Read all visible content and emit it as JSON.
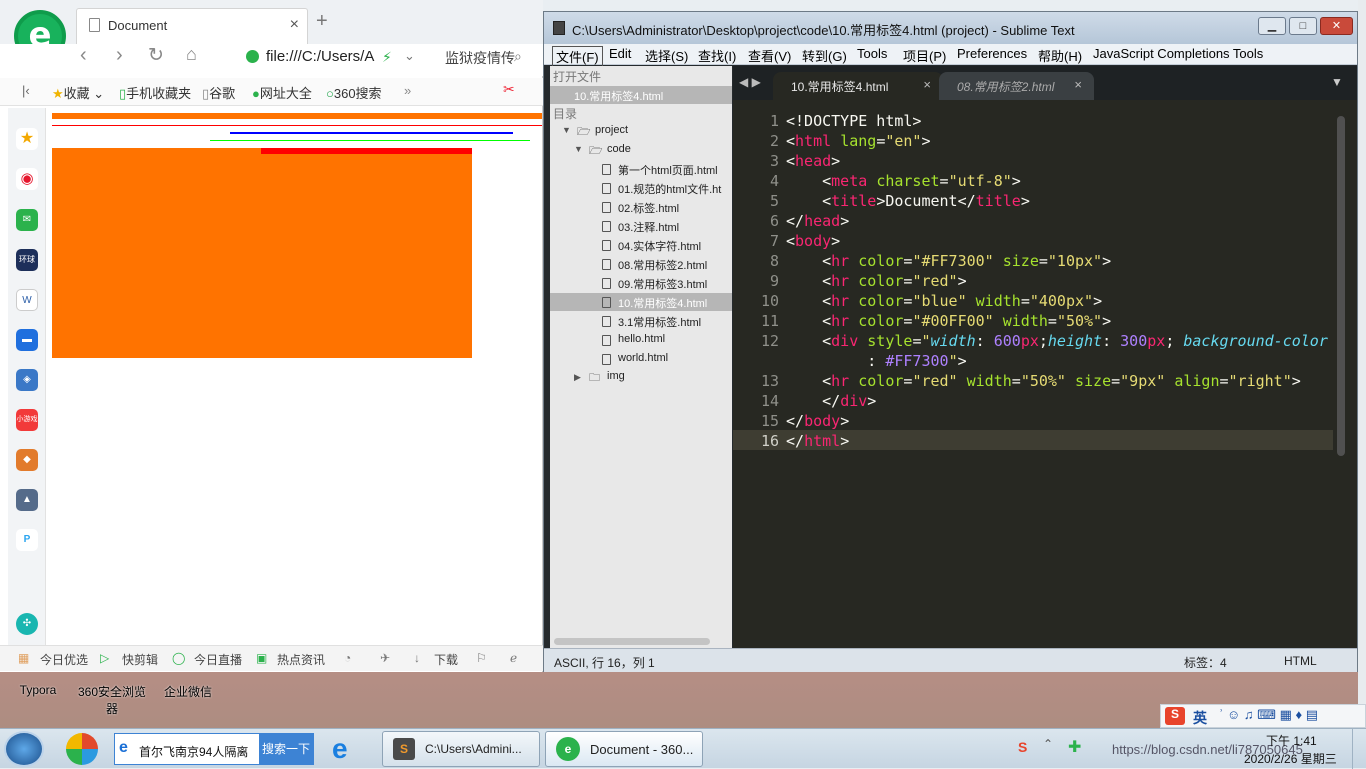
{
  "browser": {
    "tab_title": "Document",
    "url": "file:///C:/Users/A",
    "hot_search": "监狱疫情传",
    "bookmarks": [
      "收藏",
      "手机收藏夹",
      "谷歌",
      "网址大全",
      "360搜索"
    ],
    "page": {
      "hr_colors": [
        "#FF7300",
        "red",
        "blue",
        "#00FF00"
      ],
      "div_color": "#FF7300",
      "inner_hr_color": "red"
    },
    "status_items": [
      "今日优选",
      "快剪辑",
      "今日直播",
      "热点资讯",
      "下载"
    ]
  },
  "sublime": {
    "title": "C:\\Users\\Administrator\\Desktop\\project\\code\\10.常用标签4.html (project) - Sublime Text",
    "menu": [
      "文件(F)",
      "Edit",
      "选择(S)",
      "查找(I)",
      "查看(V)",
      "转到(G)",
      "Tools",
      "项目(P)",
      "Preferences",
      "帮助(H)",
      "JavaScript Completions Tools"
    ],
    "sidebar": {
      "open_files_header": "打开文件",
      "open_file": "10.常用标签4.html",
      "folders_header": "目录",
      "project": "project",
      "code": "code",
      "files": [
        "第一个html页面.html",
        "01.规范的html文件.ht",
        "02.标签.html",
        "03.注释.html",
        "04.实体字符.html",
        "08.常用标签2.html",
        "09.常用标签3.html",
        "10.常用标签4.html",
        "3.1常用标签.html",
        "hello.html",
        "world.html"
      ],
      "img": "img"
    },
    "tabs": [
      "10.常用标签4.html",
      "08.常用标签2.html"
    ],
    "line_numbers": [
      "1",
      "2",
      "3",
      "4",
      "5",
      "6",
      "7",
      "8",
      "9",
      "10",
      "11",
      "12",
      "",
      "13",
      "14",
      "15",
      "16"
    ],
    "status_left": "ASCII, 行 16，列 1",
    "status_mid": "标签：4",
    "status_right": "HTML"
  },
  "desktop": {
    "icons": [
      "Typora",
      "360安全浏览器",
      "企业微信"
    ]
  },
  "taskbar": {
    "search_text": "首尔飞南京94人隔离",
    "search_button": "搜索一下",
    "items": [
      "C:\\Users\\Admini...",
      "Document - 360..."
    ],
    "time": "下午 1:41",
    "date": "2020/2/26 星期三",
    "watermark": "https://blog.csdn.net/li787050645",
    "ime": "英"
  }
}
